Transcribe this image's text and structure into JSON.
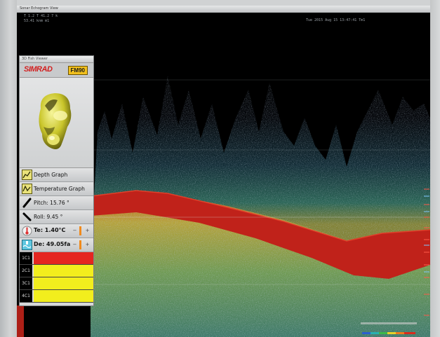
{
  "window": {
    "title": "Sonar Echogram View"
  },
  "readout": {
    "top_left_1": "T 1.2  T 41.2 7 k",
    "top_left_2": "53.41 knm  m1",
    "top_right": "Tue 2015 Aug 15 13:47:41 Tm1"
  },
  "panel": {
    "title": "3D Fish Viewer",
    "brand": "SIMRAD",
    "model": "FM90",
    "rows": {
      "depth_graph": "Depth Graph",
      "temperature_graph": "Temperature Graph",
      "pitch": "Pitch: 15.76 °",
      "roll": "Roll: 9.45 °",
      "temperature": "Te: 1.40°C",
      "depth": "De: 49.05fa"
    },
    "channels": [
      {
        "tag": "1C1",
        "color": "#e52620"
      },
      {
        "tag": "2C1",
        "color": "#f2ee1d"
      },
      {
        "tag": "3C1",
        "color": "#f2ee1d"
      },
      {
        "tag": "4C1",
        "color": "#f2ee1d"
      }
    ]
  },
  "colors": {
    "seabed": "#c0221a",
    "brand": "#d21f1f",
    "model_badge": "#f2c01d",
    "accent": "#f08a1c"
  }
}
